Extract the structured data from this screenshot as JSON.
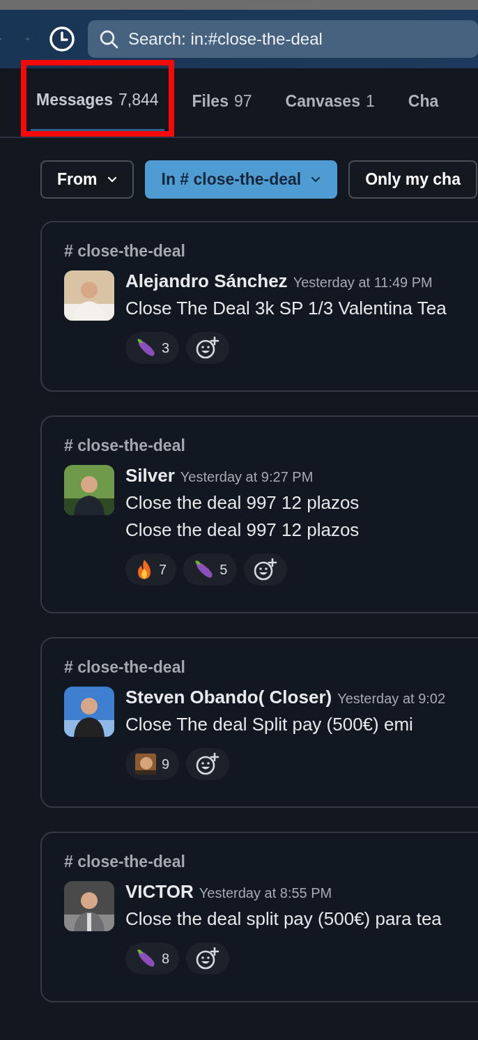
{
  "toolbar": {
    "search": {
      "value": "Search: in:#close-the-deal"
    }
  },
  "tabs": [
    {
      "label": "Messages",
      "count": "7,844",
      "selected": true,
      "highlighted": true
    },
    {
      "label": "Files",
      "count": "97",
      "selected": false,
      "highlighted": false
    },
    {
      "label": "Canvases",
      "count": "1",
      "selected": false,
      "highlighted": false
    },
    {
      "label": "Cha",
      "selected": false,
      "highlighted": false
    }
  ],
  "filters": [
    {
      "label": "From",
      "selected": false,
      "dropdown": true
    },
    {
      "label": "In # close-the-deal",
      "selected": true,
      "dropdown": true
    },
    {
      "label": "Only my cha",
      "selected": false,
      "dropdown": false
    }
  ],
  "results": [
    {
      "channel": "# close-the-deal",
      "author": "Alejandro Sánchez",
      "time": "Yesterday at 11:49 PM",
      "lines": [
        "Close The Deal 3k SP 1/3 Valentina Tea"
      ],
      "reactions": [
        {
          "kind": "eggplant",
          "count": "3"
        }
      ]
    },
    {
      "channel": "# close-the-deal",
      "author": "Silver",
      "time": "Yesterday at 9:27 PM",
      "lines": [
        "Close the deal 997 12 plazos",
        "Close the deal 997 12 plazos"
      ],
      "reactions": [
        {
          "kind": "fire",
          "count": "7"
        },
        {
          "kind": "eggplant",
          "count": "5"
        }
      ]
    },
    {
      "channel": "# close-the-deal",
      "author": "Steven Obando( Closer)",
      "time": "Yesterday at 9:02",
      "lines": [
        "Close The deal Split pay (500€) emi"
      ],
      "reactions": [
        {
          "kind": "custom",
          "count": "9"
        }
      ]
    },
    {
      "channel": "# close-the-deal",
      "author": "VICTOR",
      "time": "Yesterday at 8:55 PM",
      "lines": [
        "Close the deal split pay (500€) para tea"
      ],
      "reactions": [
        {
          "kind": "eggplant",
          "count": "8"
        }
      ]
    }
  ]
}
